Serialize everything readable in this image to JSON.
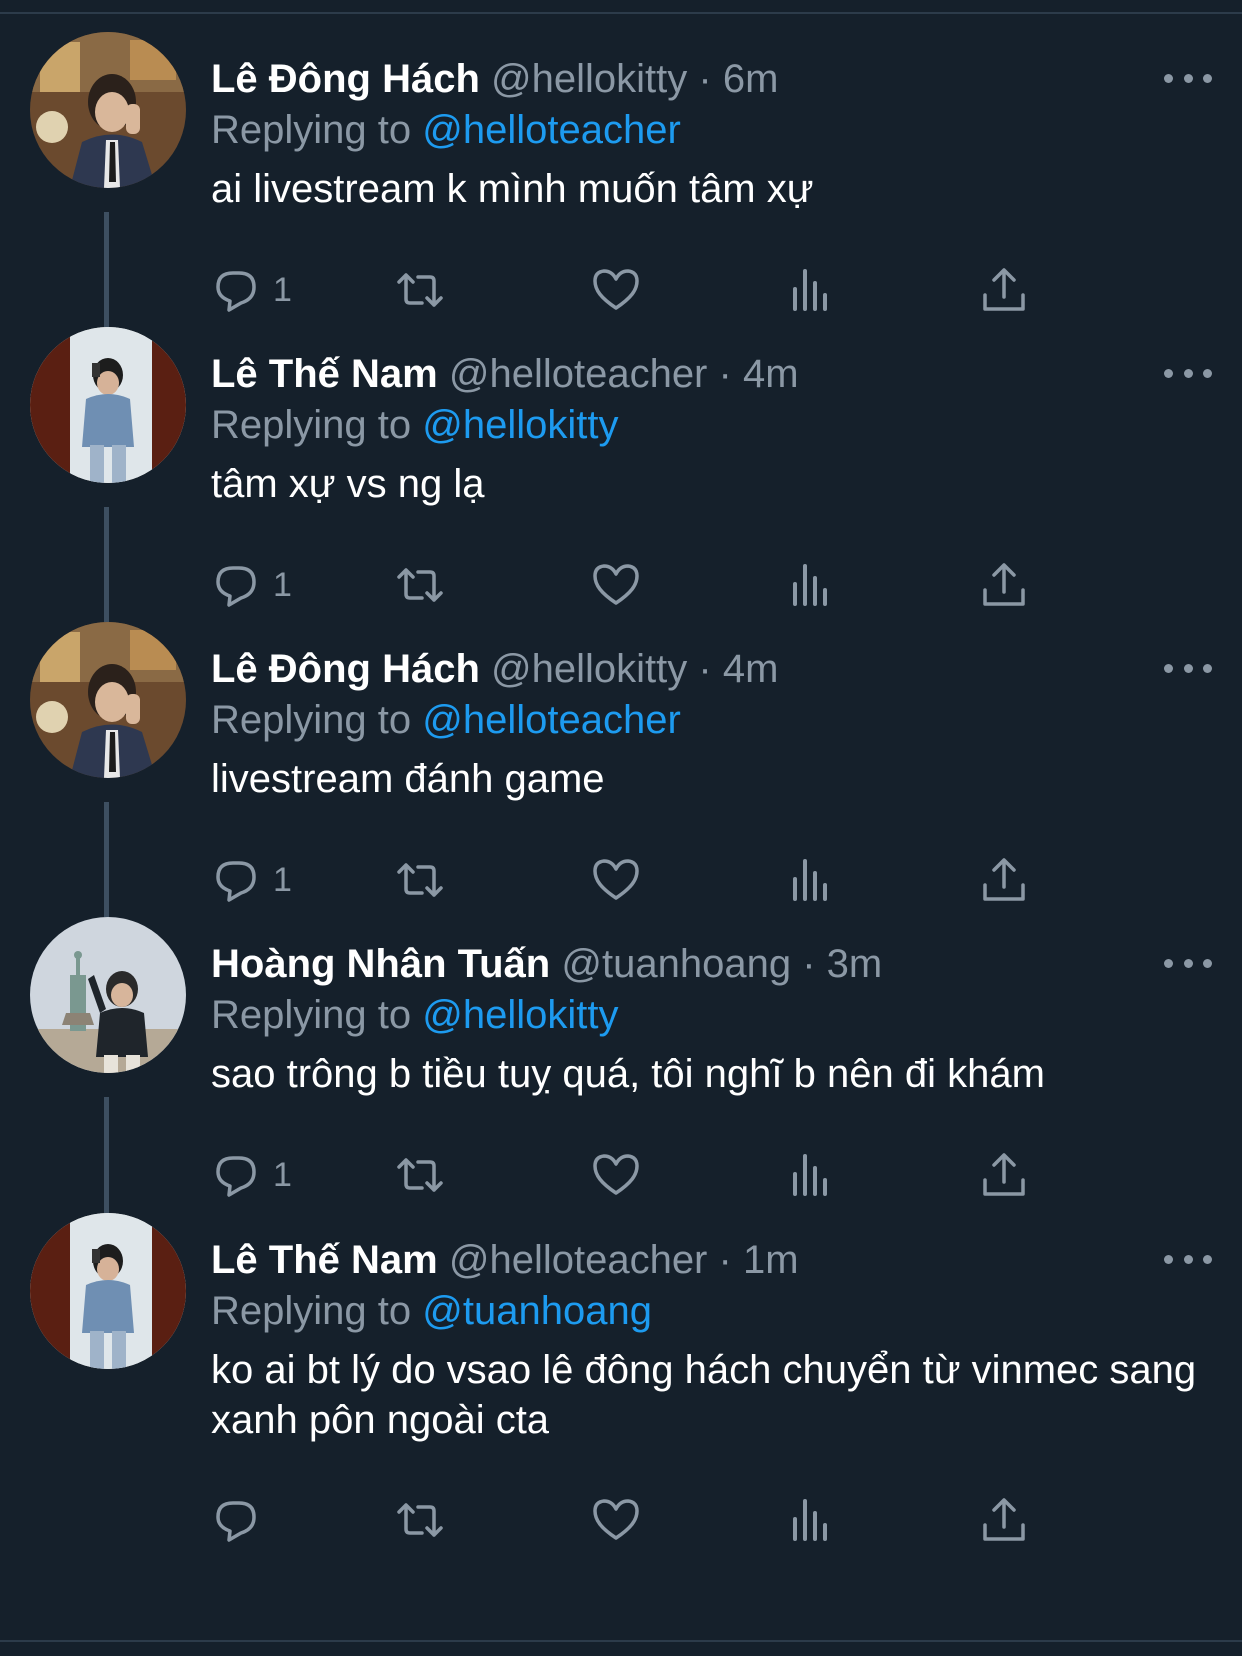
{
  "colors": {
    "background": "#15202b",
    "text": "#ffffff",
    "secondary": "#8b98a5",
    "mention": "#1d9bf0",
    "divider": "#2c3b4a"
  },
  "tweets": [
    {
      "name": "Lê Đông Hách",
      "handle": "@hellokitty",
      "time": "· 6m",
      "replying_label": "Replying to",
      "replying_to": "@helloteacher",
      "text": "ai livestream k mình muốn tâm xự",
      "reply_count": "1",
      "avatar_icon": "portrait-suit-avatar"
    },
    {
      "name": "Lê Thế Nam",
      "handle": "@helloteacher",
      "time": "· 4m",
      "replying_label": "Replying to",
      "replying_to": "@hellokitty",
      "text": "tâm xự vs ng lạ",
      "reply_count": "1",
      "avatar_icon": "mirror-selfie-avatar"
    },
    {
      "name": "Lê Đông Hách",
      "handle": "@hellokitty",
      "time": "· 4m",
      "replying_label": "Replying to",
      "replying_to": "@helloteacher",
      "text": "livestream đánh game",
      "reply_count": "1",
      "avatar_icon": "portrait-suit-avatar"
    },
    {
      "name": "Hoàng Nhân Tuấn",
      "handle": "@tuanhoang",
      "time": "· 3m",
      "replying_label": "Replying to",
      "replying_to": "@hellokitty",
      "text": "sao trông b tiều tuỵ quá, tôi nghĩ b nên đi khám",
      "reply_count": "1",
      "avatar_icon": "statue-of-liberty-avatar"
    },
    {
      "name": "Lê Thế Nam",
      "handle": "@helloteacher",
      "time": "· 1m",
      "replying_label": "Replying to",
      "replying_to": "@tuanhoang",
      "text": "ko ai bt lý do vsao lê đông hách chuyển từ vinmec sang xanh pôn ngoài cta",
      "reply_count": "",
      "avatar_icon": "mirror-selfie-avatar"
    }
  ],
  "action_icons": [
    "reply-icon",
    "retweet-icon",
    "like-icon",
    "views-icon",
    "share-icon"
  ]
}
